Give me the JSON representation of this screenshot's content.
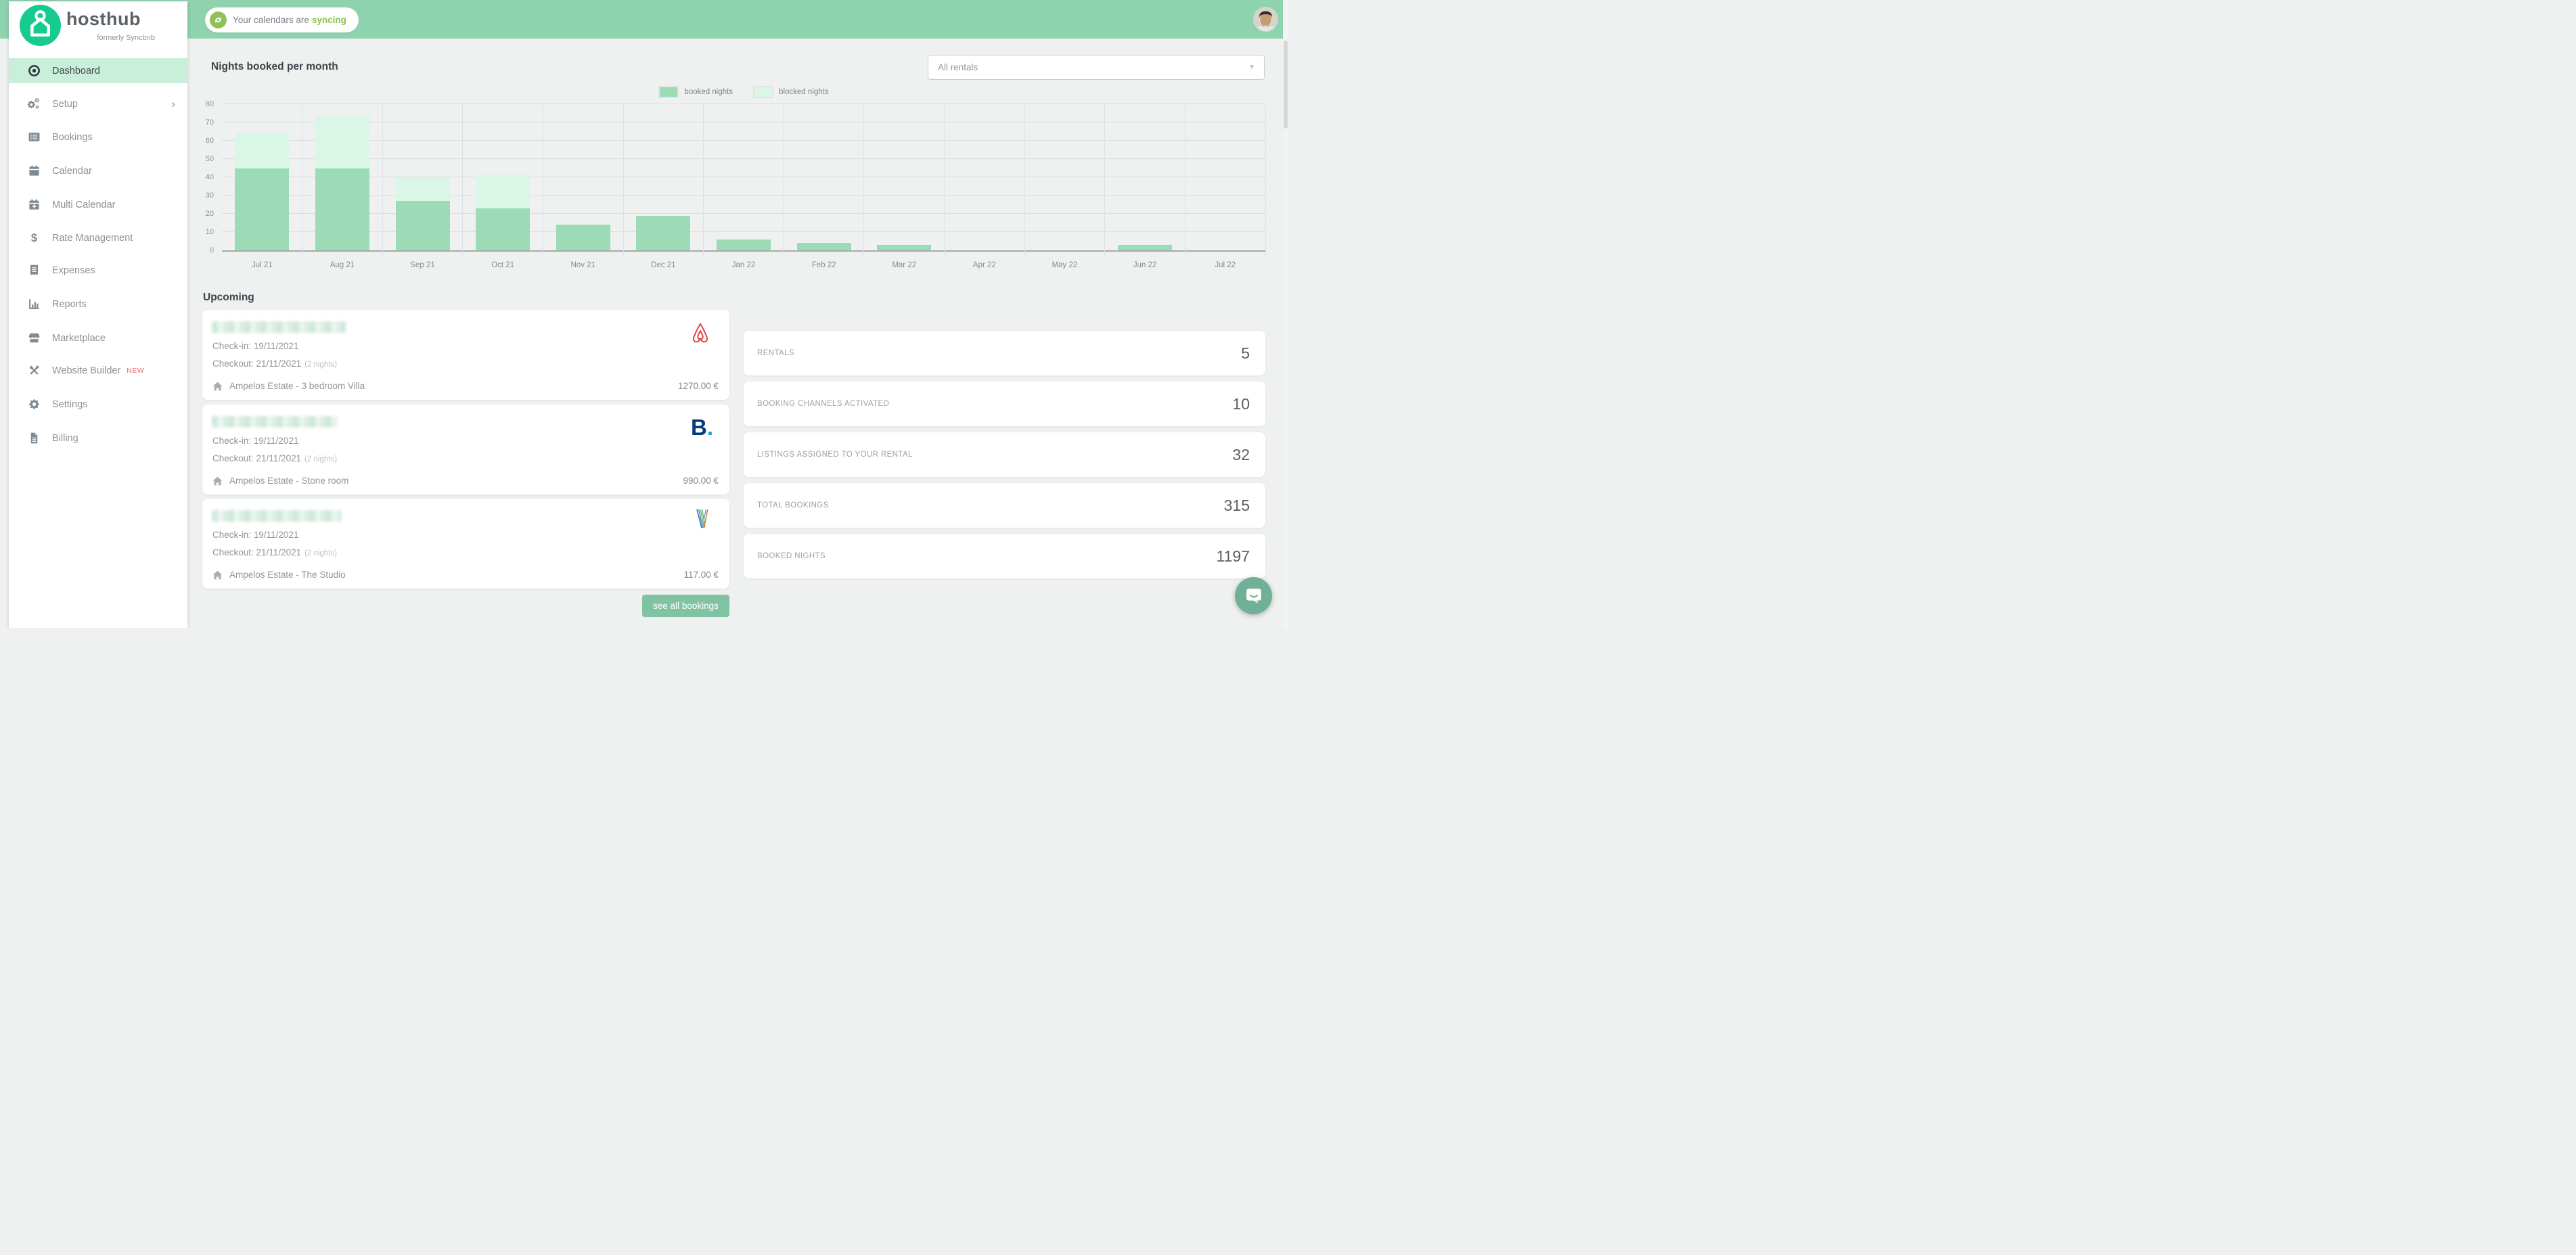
{
  "page_title": "Hosthub Dashboard",
  "topbar": {
    "sync_prefix": "Your calendars are",
    "sync_highlight": "syncing"
  },
  "logo": {
    "name": "hosthub",
    "tagline": "formerly Syncbnb"
  },
  "sidebar": {
    "items": [
      {
        "label": "Dashboard",
        "active": true
      },
      {
        "label": "Setup",
        "has_submenu": true
      },
      {
        "label": "Bookings"
      },
      {
        "label": "Calendar"
      },
      {
        "label": "Multi Calendar"
      },
      {
        "label": "Rate Management"
      },
      {
        "label": "Expenses"
      },
      {
        "label": "Reports"
      },
      {
        "label": "Marketplace"
      },
      {
        "label": "Website Builder",
        "badge": "NEW"
      },
      {
        "label": "Settings"
      },
      {
        "label": "Billing"
      }
    ]
  },
  "filter": {
    "value": "All rentals"
  },
  "chart_data": {
    "type": "bar",
    "stacked": true,
    "title": "Nights booked per month",
    "categories": [
      "Jul 21",
      "Aug 21",
      "Sep 21",
      "Oct 21",
      "Nov 21",
      "Dec 21",
      "Jan 22",
      "Feb 22",
      "Mar 22",
      "Apr 22",
      "May 22",
      "Jun 22",
      "Jul 22"
    ],
    "series": [
      {
        "name": "booked nights",
        "color": "#9bdbb5",
        "values": [
          45,
          45,
          27,
          23,
          14,
          19,
          6,
          4,
          3,
          0,
          0,
          3,
          0
        ]
      },
      {
        "name": "blocked nights",
        "color": "#d9f6e7",
        "values": [
          19,
          29,
          13,
          18,
          0,
          0,
          0,
          0,
          0,
          0,
          0,
          0,
          0
        ]
      }
    ],
    "ylim": [
      0,
      80
    ],
    "ytick_step": 10,
    "grid": true,
    "legend_position": "top"
  },
  "upcoming": {
    "title": "Upcoming",
    "see_all_label": "see all bookings",
    "bookings": [
      {
        "channel": "airbnb",
        "checkin": "Check-in: 19/11/2021",
        "checkout": "Checkout: 21/11/2021",
        "nights": "(2 nights)",
        "property": "Ampelos Estate - 3 bedroom Villa",
        "price": "1270.00 €"
      },
      {
        "channel": "booking-com",
        "logo_text": "B",
        "logo_dot": ".",
        "checkin": "Check-in: 19/11/2021",
        "checkout": "Checkout: 21/11/2021",
        "nights": "(2 nights)",
        "property": "Ampelos Estate - Stone room",
        "price": "990.00 €"
      },
      {
        "channel": "vrbo",
        "checkin": "Check-in: 19/11/2021",
        "checkout": "Checkout: 21/11/2021",
        "nights": "(2 nights)",
        "property": "Ampelos Estate - The Studio",
        "price": "117.00 €"
      }
    ]
  },
  "stats": [
    {
      "label": "RENTALS",
      "value": "5"
    },
    {
      "label": "BOOKING CHANNELS ACTIVATED",
      "value": "10"
    },
    {
      "label": "LISTINGS ASSIGNED TO YOUR RENTAL",
      "value": "32"
    },
    {
      "label": "TOTAL BOOKINGS",
      "value": "315"
    },
    {
      "label": "BOOKED NIGHTS",
      "value": "1197"
    }
  ],
  "colors": {
    "topbar_green": "#8fd2ae",
    "brand_green": "#15cb8f",
    "active_item_bg": "#c9efda",
    "booked_bar": "#9bdbb5",
    "blocked_bar": "#d9f6e7",
    "button_green": "#80c3a2",
    "badge_new_red": "#e36c6c",
    "sync_highlight_green": "#8bc34a",
    "airbnb_red": "#e0484e",
    "booking_navy": "#013b7c",
    "booking_dot_blue": "#0ba3e2"
  }
}
